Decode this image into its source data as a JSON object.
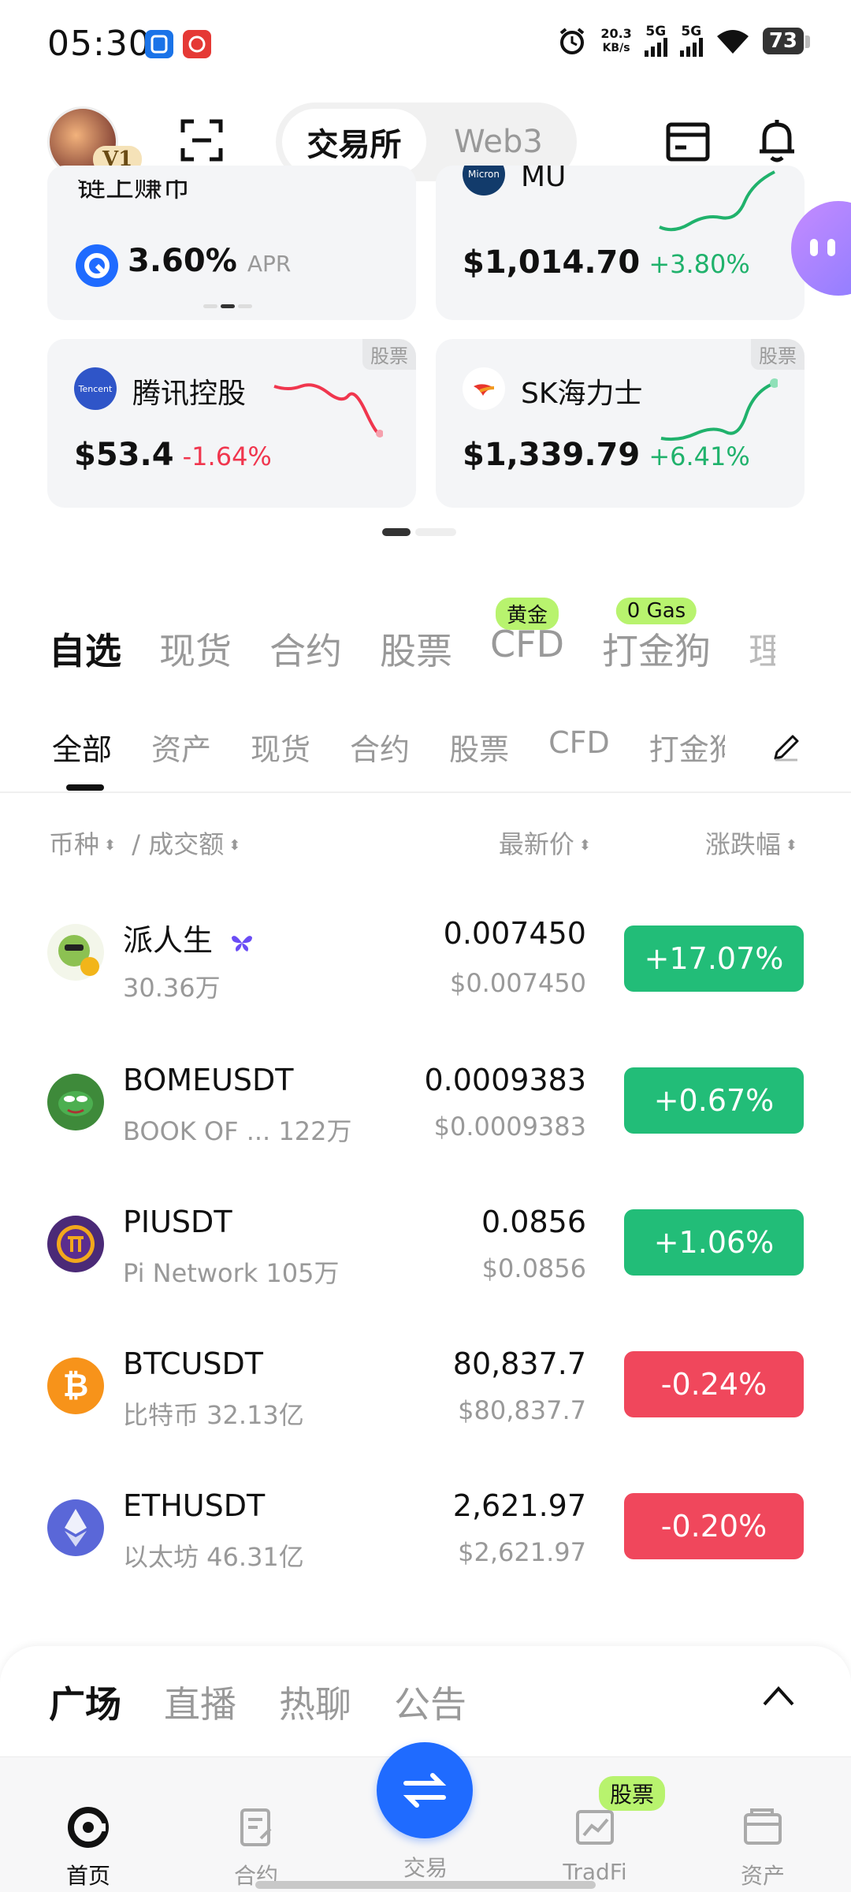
{
  "status_bar": {
    "time": "05:30",
    "net_speed_value": "20.3",
    "net_speed_unit": "KB/s",
    "signal_1": "5G",
    "signal_2": "5G",
    "battery": "73"
  },
  "header": {
    "avatar_badge": "V1",
    "segment": {
      "active": "交易所",
      "inactive": "Web3"
    }
  },
  "cards": {
    "earn": {
      "title": "链上赚币",
      "value": "3.60%",
      "unit": "APR"
    },
    "mu": {
      "logo_text": "Micron",
      "title": "MU",
      "price": "$1,014.70",
      "change": "+3.80%"
    },
    "tencent": {
      "logo_text": "Tencent",
      "title": "腾讯控股",
      "price": "$53.4",
      "change": "-1.64%",
      "tag": "股票"
    },
    "sk": {
      "title": "SK海力士",
      "price": "$1,339.79",
      "change": "+6.41%",
      "tag": "股票"
    }
  },
  "category_tabs": [
    {
      "label": "自选",
      "badge": ""
    },
    {
      "label": "现货",
      "badge": ""
    },
    {
      "label": "合约",
      "badge": ""
    },
    {
      "label": "股票",
      "badge": ""
    },
    {
      "label": "CFD",
      "badge": "黄金"
    },
    {
      "label": "打金狗",
      "badge": "0 Gas"
    },
    {
      "label": "理",
      "badge": ""
    }
  ],
  "sub_tabs": [
    "全部",
    "资产",
    "现货",
    "合约",
    "股票",
    "CFD",
    "打金狗"
  ],
  "columns": {
    "coin": "币种",
    "volume": "/ 成交额",
    "price": "最新价",
    "change": "涨跌幅"
  },
  "rows": [
    {
      "name": "派人生",
      "sub": "30.36万",
      "price": "0.007450",
      "price_usd": "$0.007450",
      "change": "+17.07%",
      "dir": "up"
    },
    {
      "name": "BOMEUSDT",
      "sub": "BOOK OF ...  122万",
      "price": "0.0009383",
      "price_usd": "$0.0009383",
      "change": "+0.67%",
      "dir": "up"
    },
    {
      "name": "PIUSDT",
      "sub": "Pi Network  105万",
      "price": "0.0856",
      "price_usd": "$0.0856",
      "change": "+1.06%",
      "dir": "up"
    },
    {
      "name": "BTCUSDT",
      "sub": "比特币  32.13亿",
      "price": "80,837.7",
      "price_usd": "$80,837.7",
      "change": "-0.24%",
      "dir": "down"
    },
    {
      "name": "ETHUSDT",
      "sub": "以太坊  46.31亿",
      "price": "2,621.97",
      "price_usd": "$2,621.97",
      "change": "-0.20%",
      "dir": "down"
    }
  ],
  "feed_tabs": [
    "广场",
    "直播",
    "热聊",
    "公告"
  ],
  "nav": {
    "home": "首页",
    "futures": "合约",
    "trade": "交易",
    "tradfi": "TradFi",
    "tradfi_badge": "股票",
    "assets": "资产"
  },
  "colors": {
    "up": "#22bd78",
    "down": "#f0475c",
    "accent": "#1f6bff",
    "badge_green": "#b8f36e"
  }
}
